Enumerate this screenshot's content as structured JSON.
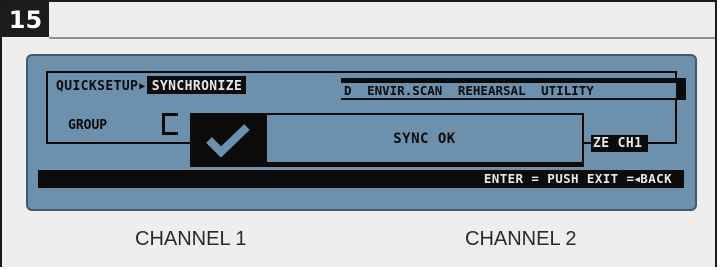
{
  "step": {
    "number": "15"
  },
  "lcd": {
    "breadcrumb": {
      "parent": "QUICKSETUP",
      "separator": "▶",
      "current": "SYNCHRONIZE"
    },
    "menu_items": [
      "D",
      "ENVIR.SCAN",
      "REHEARSAL",
      "UTILITY"
    ],
    "group_label": "GROUP",
    "popup": {
      "icon": "checkmark-icon",
      "message": "SYNC OK"
    },
    "channel_tag": "ZE CH1",
    "status": {
      "enter": "ENTER = PUSH",
      "exit": "EXIT =",
      "exit_arrow": "◀",
      "back": "BACK"
    }
  },
  "captions": {
    "channel1": "CHANNEL 1",
    "channel2": "CHANNEL 2"
  },
  "colors": {
    "lcd_background": "#6d90ad",
    "lcd_text": "#0b0b0b",
    "badge": "#1c1c1c"
  }
}
